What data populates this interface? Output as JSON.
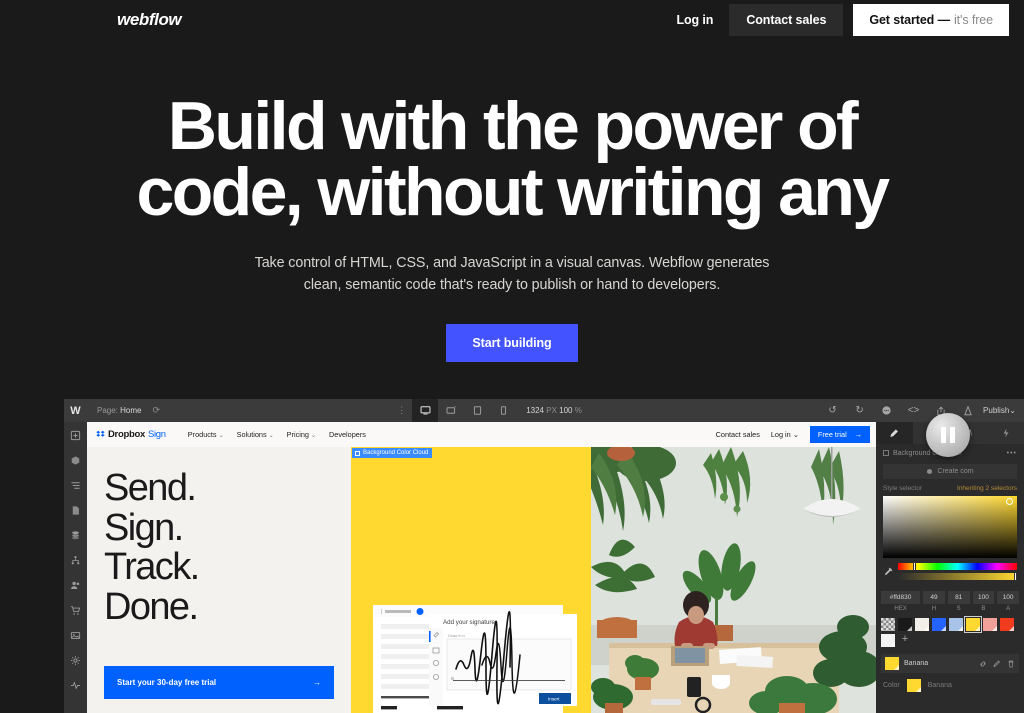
{
  "topnav": {
    "logo": "webflow",
    "login": "Log in",
    "contact_sales": "Contact sales",
    "get_started": "Get started —",
    "get_started_free": "it's free"
  },
  "hero": {
    "title_line1": "Build with the power of",
    "title_line2": "code, without writing any",
    "subtitle_line1": "Take control of HTML, CSS, and JavaScript in a visual canvas. Webflow generates",
    "subtitle_line2": "clean, semantic code that's ready to publish or hand to developers.",
    "cta": "Start building",
    "cta_color": "#4353ff"
  },
  "designer": {
    "topbar": {
      "logo": "W",
      "page_label": "Page:",
      "page_name": "Home",
      "canvas_width": "1324",
      "canvas_unit": "PX",
      "zoom": "100",
      "zoom_unit": "%",
      "publish": "Publish",
      "publish_chevron": "⌄",
      "devices": [
        "desktop-icon",
        "tablet-landscape-icon",
        "tablet-icon",
        "mobile-icon"
      ],
      "actions": [
        "undo-icon",
        "redo-icon",
        "comment-icon",
        "code-export-icon",
        "share-icon",
        "publish-rocket-icon"
      ]
    },
    "rail_items": [
      "add-elements-icon",
      "components-icon",
      "navigator-icon",
      "pages-icon",
      "cms-icon",
      "logic-icon",
      "users-icon",
      "ecommerce-icon",
      "assets-icon",
      "settings-icon",
      "audit-icon"
    ],
    "selection_badge": "Background Color Cloud",
    "panel": {
      "tabs": [
        "style-brush-icon",
        "settings-gear-icon",
        "interactions-icon",
        "effects-icon"
      ],
      "selector_label": "Background Color Clo",
      "selector_menu": "•••",
      "create_component": "Create com",
      "style_selector_label": "Style selector",
      "inheriting": "Inheriting 2 selectors",
      "fields": [
        {
          "label": "HEX",
          "value": "#ffd830"
        },
        {
          "label": "H",
          "value": "49"
        },
        {
          "label": "S",
          "value": "81"
        },
        {
          "label": "B",
          "value": "100"
        },
        {
          "label": "A",
          "value": "100"
        }
      ],
      "swatches": [
        {
          "name": "transparent",
          "color": "transparent"
        },
        {
          "name": "black",
          "color": "#1a1a1a"
        },
        {
          "name": "cream",
          "color": "#f2efe8"
        },
        {
          "name": "blue",
          "color": "#2563ff"
        },
        {
          "name": "light-blue",
          "color": "#a9c3e8"
        },
        {
          "name": "banana",
          "color": "#ffd830"
        },
        {
          "name": "salmon",
          "color": "#f2a09a"
        },
        {
          "name": "red-orange",
          "color": "#f03b1e"
        },
        {
          "name": "white",
          "color": "#f3f3f3"
        }
      ],
      "add_swatch": "+",
      "named_swatch": "Banana",
      "named_tools": [
        "link-icon",
        "edit-pencil-icon",
        "delete-trash-icon"
      ],
      "color_row_label": "Color",
      "color_row_value": "Banana"
    },
    "site": {
      "brand": "Dropbox",
      "brand_accent": "Sign",
      "nav_links": [
        "Products",
        "Solutions",
        "Pricing",
        "Developers"
      ],
      "contact_sales": "Contact sales",
      "log_in": "Log in",
      "free_trial": "Free trial",
      "headline": [
        "Send.",
        "Sign.",
        "Track.",
        "Done."
      ],
      "cta": "Start your 30-day free trial",
      "cta_arrow": "→",
      "accent_yellow": "#ffd830",
      "accent_blue": "#0061fe",
      "signature_modal_title": "Add your signature",
      "signature_insert": "Insert"
    }
  },
  "player": {
    "pause": "pause-button"
  }
}
